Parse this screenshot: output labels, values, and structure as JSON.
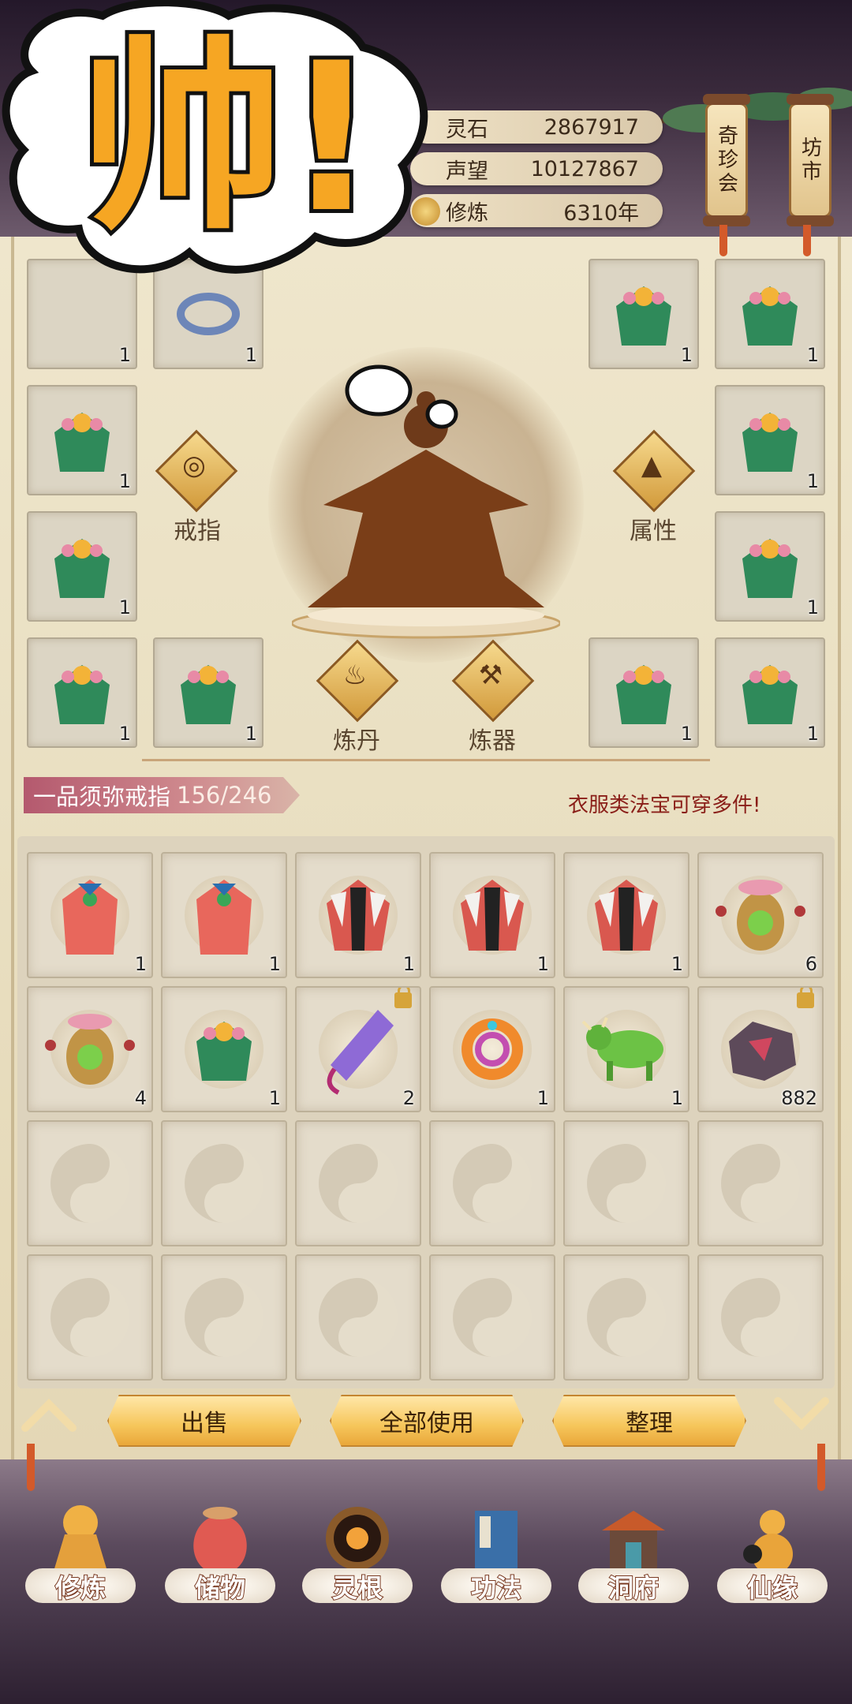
{
  "resources": [
    {
      "label": "灵石",
      "value": "2867917"
    },
    {
      "label": "声望",
      "value": "10127867"
    },
    {
      "label": "修炼",
      "value": "6310年"
    }
  ],
  "side_buttons": [
    {
      "label": "奇珍会"
    },
    {
      "label": "坊市"
    }
  ],
  "sticker_text": "帅!",
  "equipment": {
    "slot_counts": {
      "left_r1c1": "1",
      "left_r1c2": "1",
      "right_r1c1": "1",
      "right_r1c2": "1",
      "left_r2": "1",
      "right_r2": "1",
      "left_r3": "1",
      "right_r3": "1",
      "left_r4c1": "1",
      "left_r4c2": "1",
      "right_r4c1": "1",
      "right_r4c2": "1"
    },
    "actions": {
      "ring": "戒指",
      "attributes": "属性",
      "alchemy": "炼丹",
      "forging": "炼器"
    }
  },
  "ring_banner": {
    "name": "一品须弥戒指",
    "capacity": "156/246"
  },
  "notice": "衣服类法宝可穿多件!",
  "inventory": [
    {
      "item": "red-robe",
      "count": "1",
      "locked": false
    },
    {
      "item": "red-robe",
      "count": "1",
      "locked": false
    },
    {
      "item": "red-white-robe",
      "count": "1",
      "locked": false
    },
    {
      "item": "red-white-robe",
      "count": "1",
      "locked": false
    },
    {
      "item": "red-white-robe",
      "count": "1",
      "locked": false
    },
    {
      "item": "spirit-pouch",
      "count": "6",
      "locked": false
    },
    {
      "item": "spirit-pouch",
      "count": "4",
      "locked": false
    },
    {
      "item": "leaf-robe",
      "count": "1",
      "locked": false
    },
    {
      "item": "jade-talisman",
      "count": "2",
      "locked": true
    },
    {
      "item": "fire-ring",
      "count": "1",
      "locked": false
    },
    {
      "item": "green-ox",
      "count": "1",
      "locked": false
    },
    {
      "item": "ore",
      "count": "882",
      "locked": true
    }
  ],
  "buttons": {
    "sell": "出售",
    "use_all": "全部使用",
    "sort": "整理"
  },
  "nav": [
    {
      "label": "修炼",
      "icon": "cultivator-icon"
    },
    {
      "label": "储物",
      "icon": "storage-bag-icon"
    },
    {
      "label": "灵根",
      "icon": "spirit-root-icon"
    },
    {
      "label": "功法",
      "icon": "manual-book-icon"
    },
    {
      "label": "洞府",
      "icon": "cave-palace-icon"
    },
    {
      "label": "仙缘",
      "icon": "gourd-icon"
    }
  ]
}
